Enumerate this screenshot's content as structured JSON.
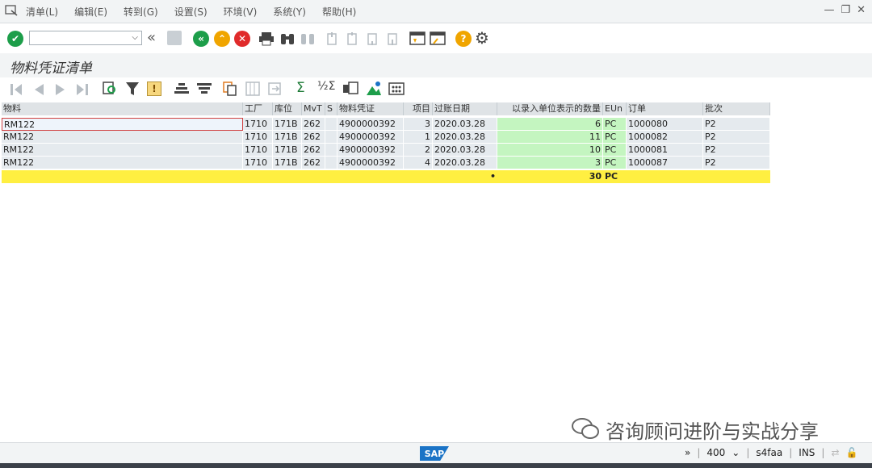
{
  "menu": {
    "items": [
      "清单(L)",
      "编辑(E)",
      "转到(G)",
      "设置(S)",
      "环境(V)",
      "系统(Y)",
      "帮助(H)"
    ]
  },
  "page": {
    "title": "物料凭证清单"
  },
  "table": {
    "headers": {
      "material": "物料",
      "plant": "工厂",
      "sloc": "库位",
      "mvt": "MvT",
      "s": "S",
      "doc": "物料凭证",
      "item": "项目",
      "postdate": "过账日期",
      "qty": "以录入单位表示的数量",
      "eun": "EUn",
      "order": "订单",
      "batch": "批次"
    },
    "rows": [
      {
        "material": "RM122",
        "plant": "1710",
        "sloc": "171B",
        "mvt": "262",
        "s": "",
        "doc": "4900000392",
        "item": "3",
        "postdate": "2020.03.28",
        "qty": "6",
        "eun": "PC",
        "order": "1000080",
        "batch": "P2"
      },
      {
        "material": "RM122",
        "plant": "1710",
        "sloc": "171B",
        "mvt": "262",
        "s": "",
        "doc": "4900000392",
        "item": "1",
        "postdate": "2020.03.28",
        "qty": "11",
        "eun": "PC",
        "order": "1000082",
        "batch": "P2"
      },
      {
        "material": "RM122",
        "plant": "1710",
        "sloc": "171B",
        "mvt": "262",
        "s": "",
        "doc": "4900000392",
        "item": "2",
        "postdate": "2020.03.28",
        "qty": "10",
        "eun": "PC",
        "order": "1000081",
        "batch": "P2"
      },
      {
        "material": "RM122",
        "plant": "1710",
        "sloc": "171B",
        "mvt": "262",
        "s": "",
        "doc": "4900000392",
        "item": "4",
        "postdate": "2020.03.28",
        "qty": "3",
        "eun": "PC",
        "order": "1000087",
        "batch": "P2"
      }
    ],
    "total": {
      "qty": "30",
      "eun": "PC",
      "marker": "•"
    }
  },
  "status": {
    "nav": "»",
    "client": "400",
    "system": "s4faa",
    "mode": "INS"
  },
  "sap_logo": "SAP",
  "watermark": "咨询顾问进阶与实战分享",
  "colors": {
    "sum_row": "#ffef41",
    "qty_col": "#c4f5c0",
    "ok_green": "#1d9e4a",
    "cancel_red": "#e02b2b",
    "help_orange": "#f0a500"
  }
}
